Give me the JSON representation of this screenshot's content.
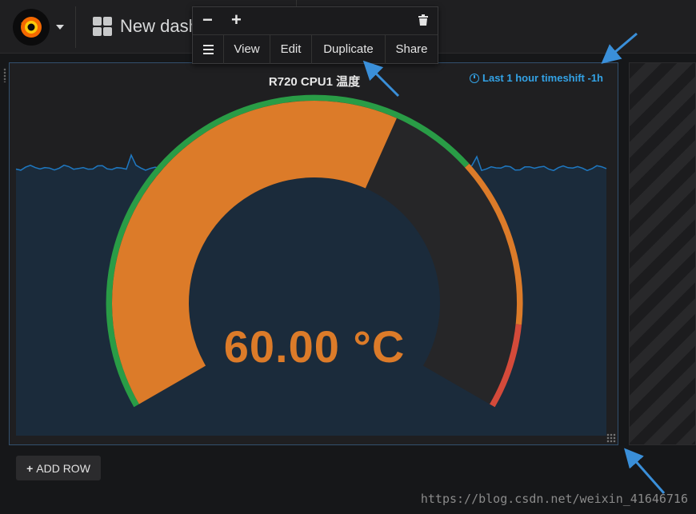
{
  "header": {
    "dashboard_title": "New dashboard"
  },
  "panel_menu": {
    "minus_label": "−",
    "plus_label": "+",
    "items": [
      "View",
      "Edit",
      "Duplicate",
      "Share"
    ]
  },
  "panel": {
    "title": "R720 CPU1 温度",
    "timeshift": "Last 1 hour timeshift -1h",
    "value_text": "60.00 °C"
  },
  "gauge": {
    "value": 60,
    "min": 0,
    "max": 100,
    "thresholds": [
      70,
      90
    ],
    "colors": {
      "ok": "#299c46",
      "warn": "#dc7b29",
      "crit": "#d44a3a",
      "value": "#dc7b29",
      "track": "#262628",
      "sparkline": "#1f78c1",
      "sparkfill": "#1b2b3b"
    }
  },
  "footer": {
    "add_row_label": "ADD ROW"
  },
  "watermark": "https://blog.csdn.net/weixin_41646716"
}
